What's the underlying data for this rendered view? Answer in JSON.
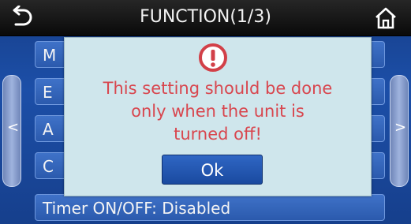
{
  "header": {
    "title": "FUNCTION(1/3)",
    "back_icon": "back-arrow-icon",
    "home_icon": "home-icon"
  },
  "nav": {
    "left_arrow": "<",
    "right_arrow": ">"
  },
  "menu": {
    "items": [
      {
        "label": "M"
      },
      {
        "label": "E"
      },
      {
        "label": "A"
      },
      {
        "label": "C"
      },
      {
        "label": "Timer ON/OFF: Disabled"
      }
    ]
  },
  "dialog": {
    "icon": "warning-icon",
    "message_lines": [
      "This setting should be done",
      "only when the unit is",
      "turned off!"
    ],
    "ok_label": "Ok"
  },
  "colors": {
    "topbar": "#111111",
    "screen_bg": "#1c4fa8",
    "dialog_bg": "#cfe6ec",
    "message": "#d8464e",
    "ok_button": "#1f53b0"
  }
}
